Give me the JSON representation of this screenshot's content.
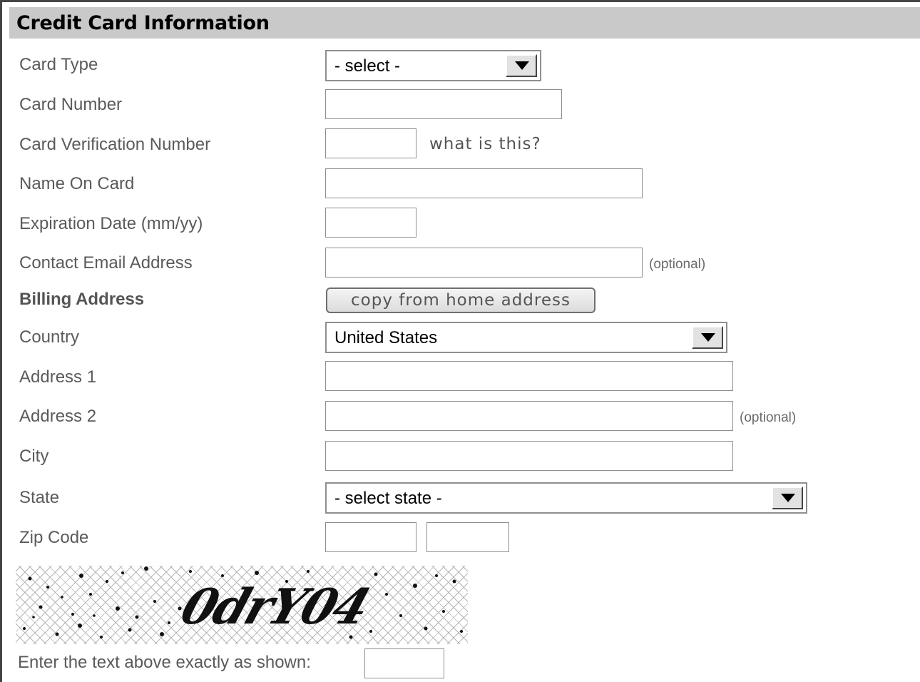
{
  "header": {
    "title": "Credit Card Information"
  },
  "form": {
    "card_type": {
      "label": "Card Type",
      "value": "- select -"
    },
    "card_number": {
      "label": "Card Number",
      "value": ""
    },
    "cvn": {
      "label": "Card Verification Number",
      "value": "",
      "help_link": "what is this?"
    },
    "name_on_card": {
      "label": "Name On Card",
      "value": ""
    },
    "expiration": {
      "label": "Expiration Date (mm/yy)",
      "value": ""
    },
    "email": {
      "label": "Contact Email Address",
      "value": "",
      "note": "(optional)"
    },
    "billing": {
      "label": "Billing Address",
      "copy_button": "copy from home address"
    },
    "country": {
      "label": "Country",
      "value": "United States"
    },
    "address1": {
      "label": "Address 1",
      "value": ""
    },
    "address2": {
      "label": "Address 2",
      "value": "",
      "note": "(optional)"
    },
    "city": {
      "label": "City",
      "value": ""
    },
    "state": {
      "label": "State",
      "value": "- select state -"
    },
    "zip": {
      "label": "Zip Code",
      "value1": "",
      "value2": ""
    }
  },
  "captcha": {
    "text": "0drY04",
    "prompt": "Enter the text above exactly as shown:",
    "value": ""
  },
  "colors": {
    "header_bg": "#c9c9c9",
    "label_text": "#5a5a5a",
    "field_border": "#8f8f8f"
  },
  "icons": {
    "dropdown": "triangle-down-icon"
  }
}
